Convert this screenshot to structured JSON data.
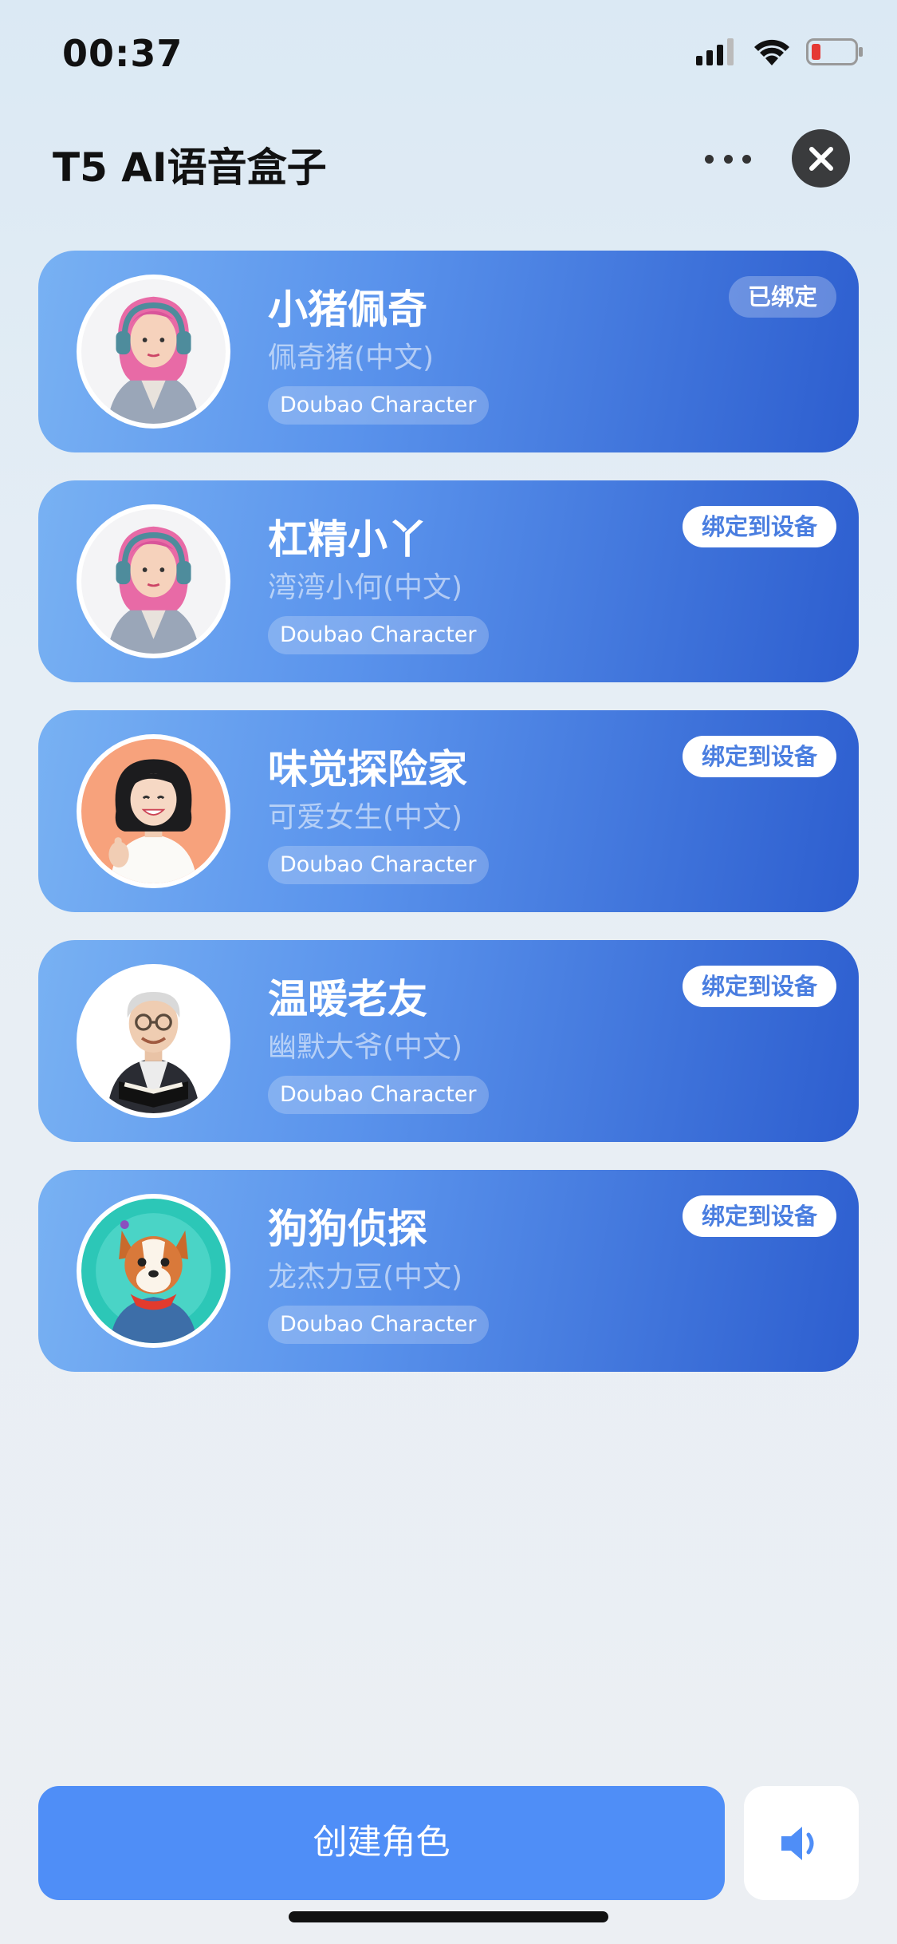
{
  "status_bar": {
    "time": "00:37",
    "icons": [
      "cellular-signal-icon",
      "wifi-icon",
      "battery-low-icon"
    ],
    "battery_color": "#e53935"
  },
  "header": {
    "title": "T5 AI语音盒子",
    "more_icon": "more-dots-icon",
    "close_icon": "close-icon"
  },
  "characters": [
    {
      "name": "小猪佩奇",
      "voice": "佩奇猪(中文)",
      "tag": "Doubao Character",
      "badge": "已绑定",
      "bound": true,
      "avatar": "pink-hair-girl-headphones"
    },
    {
      "name": "杠精小丫",
      "voice": "湾湾小何(中文)",
      "tag": "Doubao Character",
      "badge": "绑定到设备",
      "bound": false,
      "avatar": "pink-hair-girl-headphones"
    },
    {
      "name": "味觉探险家",
      "voice": "可爱女生(中文)",
      "tag": "Doubao Character",
      "badge": "绑定到设备",
      "bound": false,
      "avatar": "smiling-girl-thumbs-up"
    },
    {
      "name": "温暖老友",
      "voice": "幽默大爷(中文)",
      "tag": "Doubao Character",
      "badge": "绑定到设备",
      "bound": false,
      "avatar": "old-man-with-book"
    },
    {
      "name": "狗狗侦探",
      "voice": "龙杰力豆(中文)",
      "tag": "Doubao Character",
      "badge": "绑定到设备",
      "bound": false,
      "avatar": "cartoon-dog-detective"
    }
  ],
  "footer": {
    "create_label": "创建角色",
    "speaker_icon": "speaker-icon"
  },
  "colors": {
    "accent": "#4f8ef7",
    "card_gradient_start": "#78b1f3",
    "card_gradient_end": "#2d5ecf"
  }
}
